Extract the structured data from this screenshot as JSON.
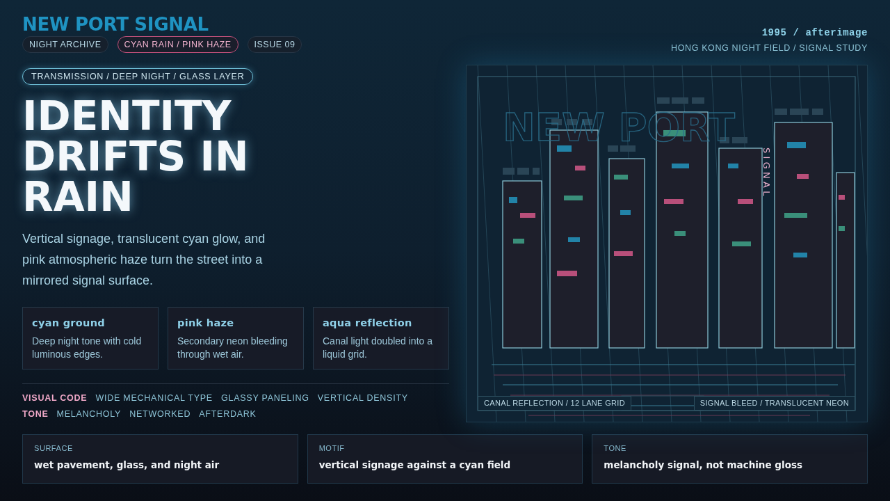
{
  "header": {
    "title": "NEW PORT SIGNAL",
    "tags": [
      {
        "label": "NIGHT ARCHIVE",
        "highlighted": false
      },
      {
        "label": "CYAN RAIN / PINK HAZE",
        "highlighted": true
      },
      {
        "label": "ISSUE 09",
        "highlighted": false
      }
    ],
    "edition": "1995 / afterimage",
    "subtitle": "HONG KONG NIGHT FIELD / SIGNAL STUDY"
  },
  "hero": {
    "badge": "TRANSMISSION / DEEP NIGHT / GLASS LAYER",
    "heading": "IDENTITY DRIFTS IN RAIN",
    "description": "Vertical signage, translucent cyan glow, and pink atmospheric haze turn the street into a mirrored signal surface."
  },
  "palette_cards": [
    {
      "title": "cyan ground",
      "text": "Deep night tone with cold luminous edges."
    },
    {
      "title": "pink haze",
      "text": "Secondary neon bleeding through wet air."
    },
    {
      "title": "aqua reflection",
      "text": "Canal light doubled into a liquid grid."
    }
  ],
  "attributes": [
    {
      "label": "VISUAL CODE",
      "values": [
        "WIDE MECHANICAL TYPE",
        "GLASSY PANELING",
        "VERTICAL DENSITY"
      ]
    },
    {
      "label": "TONE",
      "values": [
        "MELANCHOLY",
        "NETWORKED",
        "AFTERDARK"
      ]
    }
  ],
  "artwork": {
    "backdrop_text": "NEW PORT",
    "vertical_sign": "SIGNAL",
    "captions": [
      "CANAL REFLECTION / 12 LANE GRID",
      "SIGNAL BLEED / TRANSLUCENT NEON"
    ]
  },
  "summary": [
    {
      "label": "SURFACE",
      "value": "wet pavement, glass, and night air"
    },
    {
      "label": "MOTIF",
      "value": "vertical signage against a cyan field"
    },
    {
      "label": "TONE",
      "value": "melancholy signal, not machine gloss"
    }
  ]
}
